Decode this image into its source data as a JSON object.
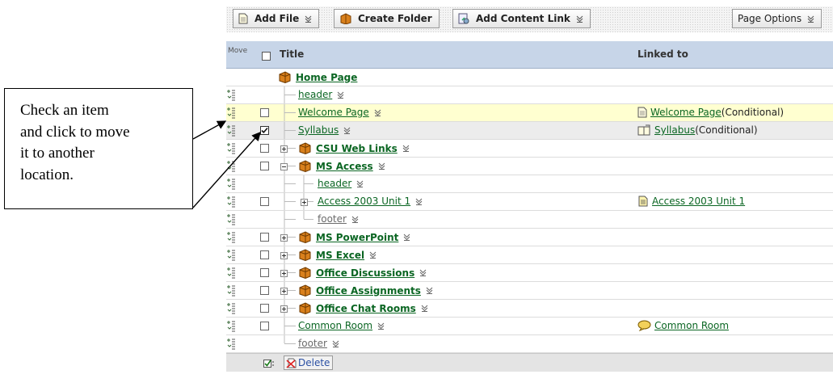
{
  "callout": {
    "lines": [
      "Check an item",
      "and click to move",
      "it to another",
      "location."
    ]
  },
  "toolbar": {
    "add_file": "Add File",
    "create_folder": "Create Folder",
    "add_content_link": "Add Content Link",
    "page_options": "Page Options"
  },
  "grid": {
    "move_header": "Move",
    "title_header": "Title",
    "linked_header": "Linked to",
    "rows": [
      {
        "title": "Home Page",
        "linked": "",
        "linked_suffix": ""
      },
      {
        "title": "header",
        "linked": "",
        "linked_suffix": ""
      },
      {
        "title": "Welcome Page",
        "linked": "Welcome Page",
        "linked_suffix": "(Conditional)"
      },
      {
        "title": "Syllabus",
        "linked": "Syllabus",
        "linked_suffix": "(Conditional)"
      },
      {
        "title": "CSU Web Links",
        "linked": "",
        "linked_suffix": ""
      },
      {
        "title": "MS Access",
        "linked": "",
        "linked_suffix": ""
      },
      {
        "title": "header",
        "linked": "",
        "linked_suffix": ""
      },
      {
        "title": "Access 2003 Unit 1",
        "linked": "Access 2003 Unit 1",
        "linked_suffix": ""
      },
      {
        "title": "footer",
        "linked": "",
        "linked_suffix": ""
      },
      {
        "title": "MS PowerPoint",
        "linked": "",
        "linked_suffix": ""
      },
      {
        "title": "MS Excel",
        "linked": "",
        "linked_suffix": ""
      },
      {
        "title": "Office Discussions",
        "linked": "",
        "linked_suffix": ""
      },
      {
        "title": "Office Assignments",
        "linked": "",
        "linked_suffix": ""
      },
      {
        "title": "Office Chat Rooms",
        "linked": "",
        "linked_suffix": ""
      },
      {
        "title": "Common Room",
        "linked": "Common Room",
        "linked_suffix": ""
      },
      {
        "title": "footer",
        "linked": "",
        "linked_suffix": ""
      }
    ]
  },
  "footer": {
    "delete_label": "Delete"
  },
  "colors": {
    "link_green": "#0b6623",
    "header_blue": "#c7d5e8",
    "highlight_yellow": "#ffffd0",
    "folder_orange": "#d9801c"
  }
}
